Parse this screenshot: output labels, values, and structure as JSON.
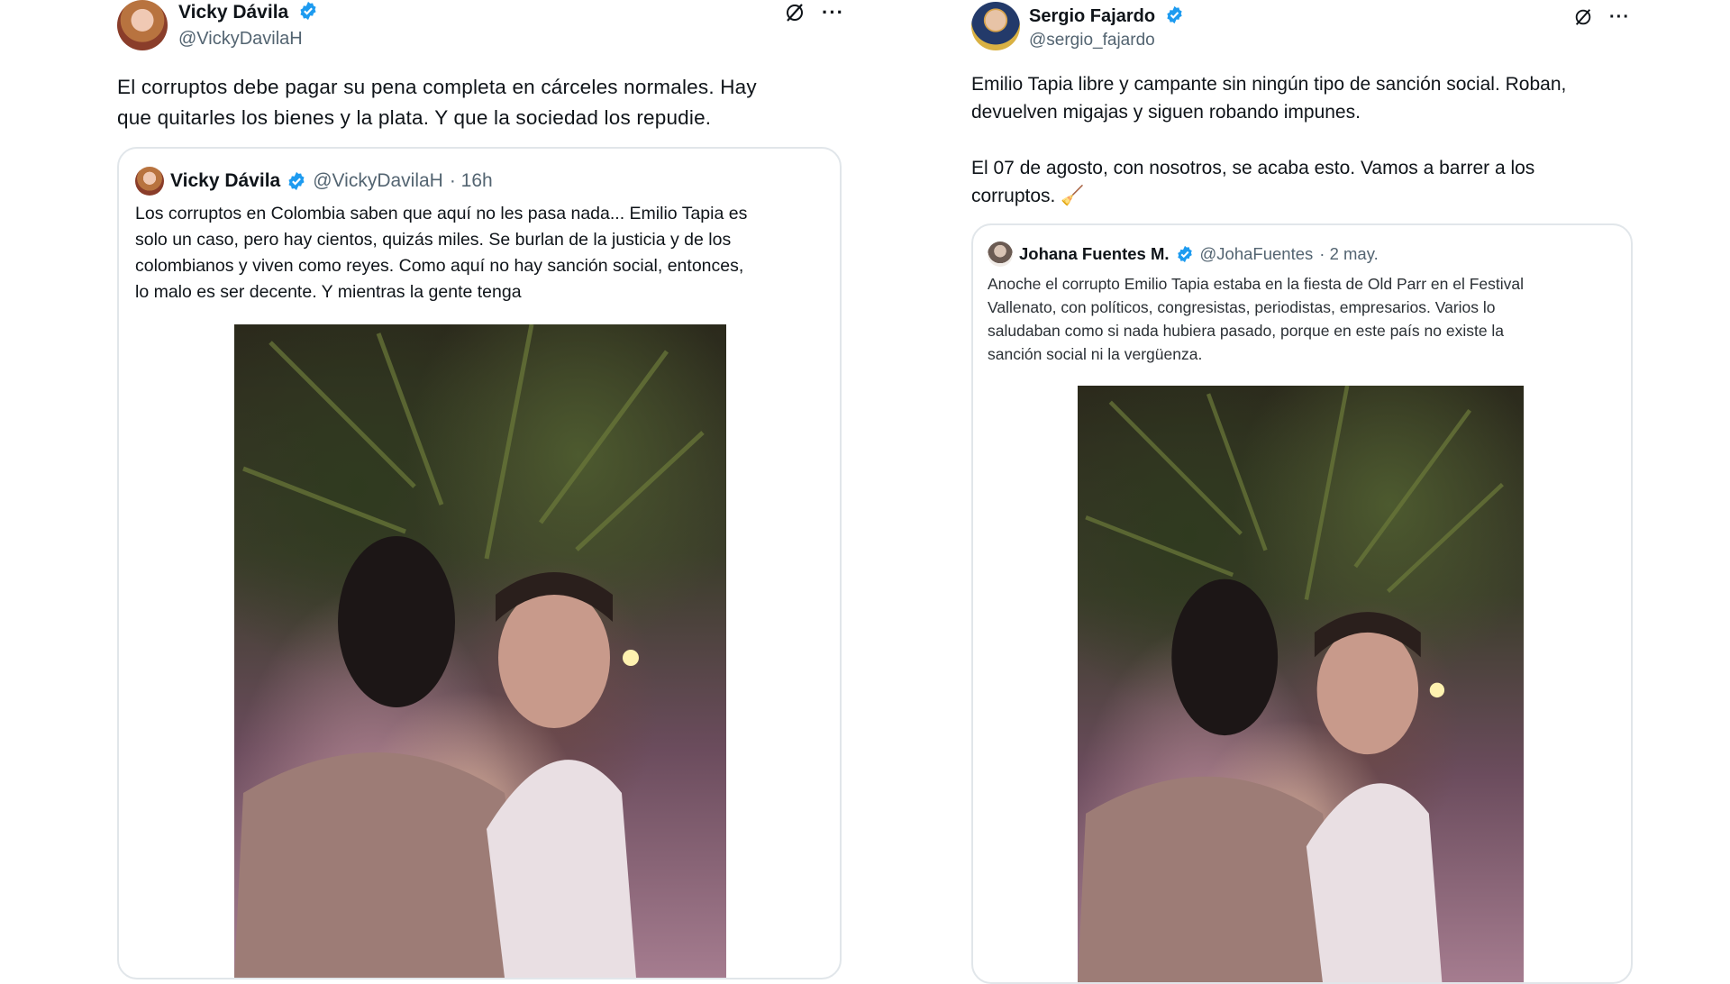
{
  "left": {
    "author": {
      "name": "Vicky Dávila",
      "handle": "@VickyDavilaH"
    },
    "text": "El corruptos debe pagar su pena completa en cárceles normales. Hay\nque quitarles los bienes y la plata. Y que la sociedad los repudie.",
    "quote": {
      "name": "Vicky Dávila",
      "handle": "@VickyDavilaH",
      "time": "· 16h",
      "text": "Los corruptos en Colombia saben que aquí no les pasa nada... Emilio Tapia es\nsolo un caso, pero hay cientos, quizás miles. Se burlan de la justicia y de los\ncolombianos y viven como reyes. Como aquí no hay sanción social, entonces,\nlo malo es ser decente. Y mientras la gente tenga"
    }
  },
  "right": {
    "author": {
      "name": "Sergio Fajardo",
      "handle": "@sergio_fajardo"
    },
    "text": "Emilio Tapia libre y campante sin ningún tipo de sanción social. Roban,\ndevuelven migajas y siguen robando impunes.\n\nEl 07 de agosto, con nosotros, se acaba esto. Vamos a barrer a los\ncorruptos. 🧹",
    "quote": {
      "name": "Johana Fuentes M.",
      "handle": "@JohaFuentes",
      "time": "· 2 may.",
      "text": "Anoche el corrupto Emilio Tapia estaba en la fiesta de Old Parr en el Festival\nVallenato, con políticos, congresistas, periodistas, empresarios. Varios lo\nsaludaban como si nada hubiera pasado, porque en este país no existe la\nsanción social ni la vergüenza."
    }
  },
  "icons": {
    "grok": "grok-icon",
    "more": "more-icon",
    "verified": "verified-badge-icon"
  },
  "colors": {
    "verified": "#1d9bf0",
    "text": "#0f1419",
    "muted": "#536471",
    "border": "#e1e6ea"
  }
}
